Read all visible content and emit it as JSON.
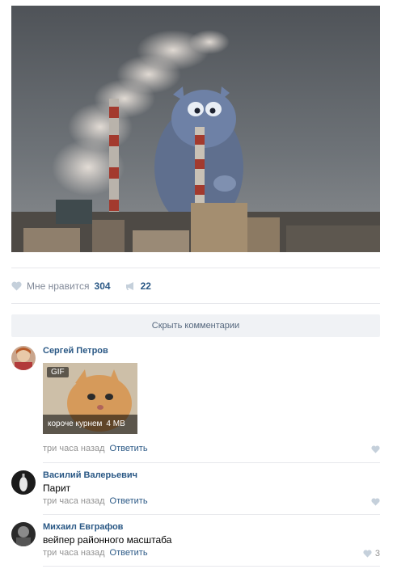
{
  "post": {
    "likes_label": "Мне нравится",
    "likes_count": "304",
    "shares_count": "22",
    "hide_comments_label": "Скрыть комментарии"
  },
  "comments": [
    {
      "author": "Сергей Петров",
      "gif_badge": "GIF",
      "gif_caption": "короче курнем",
      "gif_size": "4 MB",
      "time": "три часа назад",
      "reply_label": "Ответить"
    },
    {
      "author": "Василий Валерьевич",
      "text": "Парит",
      "time": "три часа назад",
      "reply_label": "Ответить"
    },
    {
      "author": "Михаил Евграфов",
      "text": "вейпер районного масштаба",
      "time": "три часа назад",
      "reply_label": "Ответить",
      "likes": "3"
    }
  ]
}
